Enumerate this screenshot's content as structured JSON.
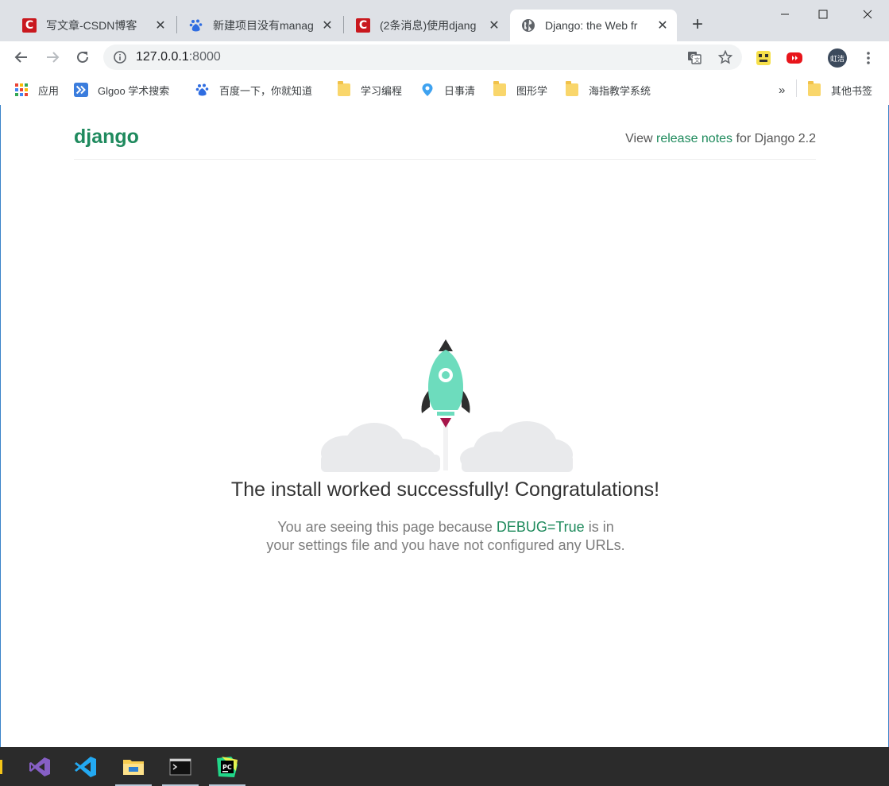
{
  "tabs": [
    {
      "title": "写文章-CSDN博客",
      "favicon": "csdn-icon"
    },
    {
      "title": "新建项目没有manag",
      "favicon": "baidu-paw-icon"
    },
    {
      "title": "(2条消息)使用djang",
      "favicon": "csdn-icon"
    },
    {
      "title": "Django: the Web fr",
      "favicon": "globe-icon",
      "active": true
    }
  ],
  "new_tab_label": "+",
  "toolbar": {
    "url_host": "127.0.0.1",
    "url_port": ":8000",
    "avatar_text": "虹洁"
  },
  "bookmarks": [
    {
      "label": "应用",
      "icon": "apps-grid-icon"
    },
    {
      "label": "Glgoo 学术搜索",
      "icon": "glgoo-icon"
    },
    {
      "label": "百度一下，你就知道",
      "icon": "baidu-paw-icon"
    },
    {
      "label": "学习编程",
      "icon": "folder-icon"
    },
    {
      "label": "日事清",
      "icon": "location-pin-icon"
    },
    {
      "label": "图形学",
      "icon": "folder-icon"
    },
    {
      "label": "海指教学系统",
      "icon": "folder-icon"
    }
  ],
  "bookmarks_overflow": "»",
  "other_bookmarks": "其他书签",
  "django_page": {
    "logo": "django",
    "release_prefix": "View ",
    "release_link": "release notes",
    "release_suffix": " for Django 2.2",
    "title": "The install worked successfully! Congratulations!",
    "sub_prefix": "You are seeing this page because ",
    "sub_debug": "DEBUG=True",
    "sub_suffix": " is in your settings file and you have not configured any URLs."
  },
  "colors": {
    "django_green": "#1e8a5c",
    "rocket_body": "#6ddcbd",
    "cloud": "#e9eaec",
    "taskbar": "#2b2b2b"
  },
  "taskbar_apps": [
    "visual-studio-icon",
    "vscode-icon",
    "file-explorer-icon",
    "terminal-icon",
    "pycharm-icon"
  ]
}
